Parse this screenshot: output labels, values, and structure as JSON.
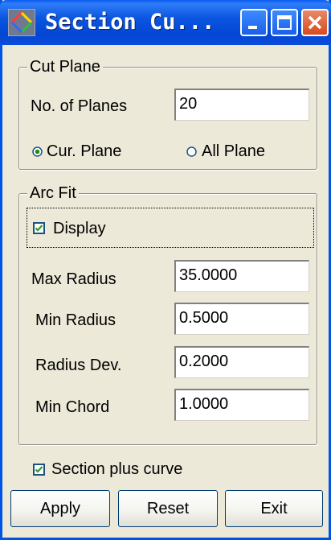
{
  "window": {
    "title": "Section Cu...",
    "icon": "diamond-app-icon",
    "controls": [
      "minimize-icon",
      "maximize-icon",
      "close-icon"
    ]
  },
  "cut_plane": {
    "legend": "Cut Plane",
    "planes_label": "No. of Planes",
    "planes_value": "20",
    "cur_plane_label": "Cur. Plane",
    "all_plane_label": "All Plane",
    "selected": "Cur. Plane"
  },
  "arc_fit": {
    "legend": "Arc Fit",
    "display_label": "Display",
    "display_checked": true,
    "max_radius_label": "Max Radius",
    "max_radius_value": "35.0000",
    "min_radius_label": "Min Radius",
    "min_radius_value": "0.5000",
    "radius_dev_label": "Radius Dev.",
    "radius_dev_value": "0.2000",
    "min_chord_label": "Min Chord",
    "min_chord_value": "1.0000"
  },
  "section_plus_curve": {
    "label": "Section plus curve",
    "checked": true
  },
  "buttons": {
    "apply": "Apply",
    "reset": "Reset",
    "exit": "Exit"
  },
  "colors": {
    "titlebar": "#0a4bd9",
    "window_bg": "#ece9d8",
    "close_button": "#d64a1c"
  }
}
